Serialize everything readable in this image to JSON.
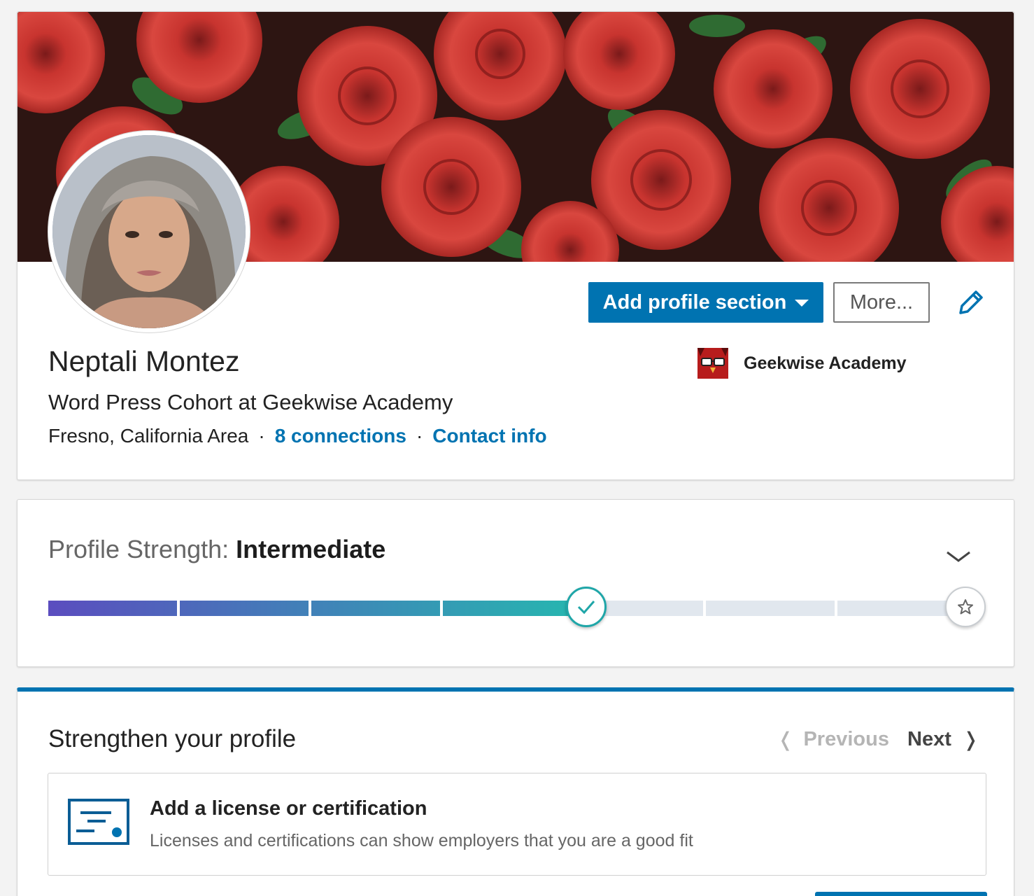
{
  "profile": {
    "name": "Neptali Montez",
    "headline": "Word Press Cohort at Geekwise Academy",
    "location": "Fresno, California Area",
    "connections": "8 connections",
    "contact_info": "Contact info",
    "company": "Geekwise Academy",
    "add_section_label": "Add profile section",
    "more_label": "More...",
    "separator": "·"
  },
  "strength": {
    "label": "Profile Strength:",
    "level": "Intermediate",
    "completed_steps": 4,
    "total_steps": 7
  },
  "strengthen": {
    "title": "Strengthen your profile",
    "previous_label": "Previous",
    "next_label": "Next",
    "suggestion_title": "Add a license or certification",
    "suggestion_desc": "Licenses and certifications can show employers that you are a good fit"
  },
  "colors": {
    "accent": "#0073b1",
    "meter_start": "#5b4dbf",
    "meter_end": "#27b5b0",
    "meter_empty": "#e1e7ee"
  },
  "icons": [
    "caret-down-icon",
    "pencil-icon",
    "chevron-down-icon",
    "checkmark-icon",
    "star-icon",
    "chevron-left-icon",
    "chevron-right-icon",
    "certificate-icon"
  ]
}
